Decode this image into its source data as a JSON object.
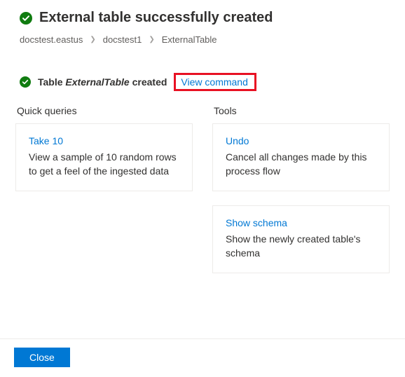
{
  "header": {
    "title": "External table successfully created"
  },
  "breadcrumb": {
    "items": [
      "docstest.eastus",
      "docstest1",
      "ExternalTable"
    ]
  },
  "message": {
    "prefix": "Table ",
    "tableName": "ExternalTable",
    "suffix": " created",
    "viewCommand": "View command"
  },
  "sections": {
    "quickQueries": {
      "title": "Quick queries",
      "cards": [
        {
          "title": "Take 10",
          "desc": "View a sample of 10 random rows to get a feel of the ingested data"
        }
      ]
    },
    "tools": {
      "title": "Tools",
      "cards": [
        {
          "title": "Undo",
          "desc": "Cancel all changes made by this process flow"
        },
        {
          "title": "Show schema",
          "desc": "Show the newly created table's schema"
        }
      ]
    }
  },
  "footer": {
    "close": "Close"
  }
}
